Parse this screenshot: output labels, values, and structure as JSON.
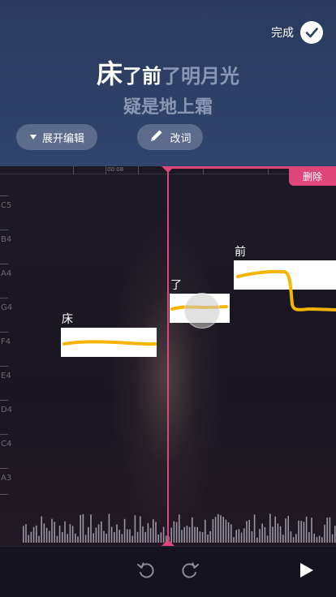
{
  "header": {
    "done_label": "完成",
    "lyrics": {
      "line1": [
        {
          "text": "床",
          "state": "active-big"
        },
        {
          "text": "了",
          "state": "active"
        },
        {
          "text": "前",
          "state": "active"
        },
        {
          "text": "了",
          "state": "dim"
        },
        {
          "text": "明",
          "state": "dim"
        },
        {
          "text": "月",
          "state": "dim"
        },
        {
          "text": "光",
          "state": "dim"
        }
      ],
      "line2": "疑是地上霜"
    },
    "expand_label": "展开编辑",
    "edit_lyrics_label": "改词"
  },
  "editor": {
    "timestamp": "00:08",
    "delete_label": "删除",
    "pitch_labels": [
      "C5",
      "B4",
      "A4",
      "G4",
      "F4",
      "E4",
      "D4",
      "C4",
      "A3"
    ],
    "notes": [
      {
        "char": "床"
      },
      {
        "char": "了"
      },
      {
        "char": "前"
      }
    ]
  },
  "icons": {
    "done": "check-circle-icon",
    "expand": "triangle-down-icon",
    "edit": "pencil-icon",
    "undo": "undo-icon",
    "redo": "redo-icon",
    "play": "play-icon"
  },
  "colors": {
    "accent": "#e0457a",
    "pitch_curve": "#f5b400",
    "header_bg": "#2e4066"
  }
}
